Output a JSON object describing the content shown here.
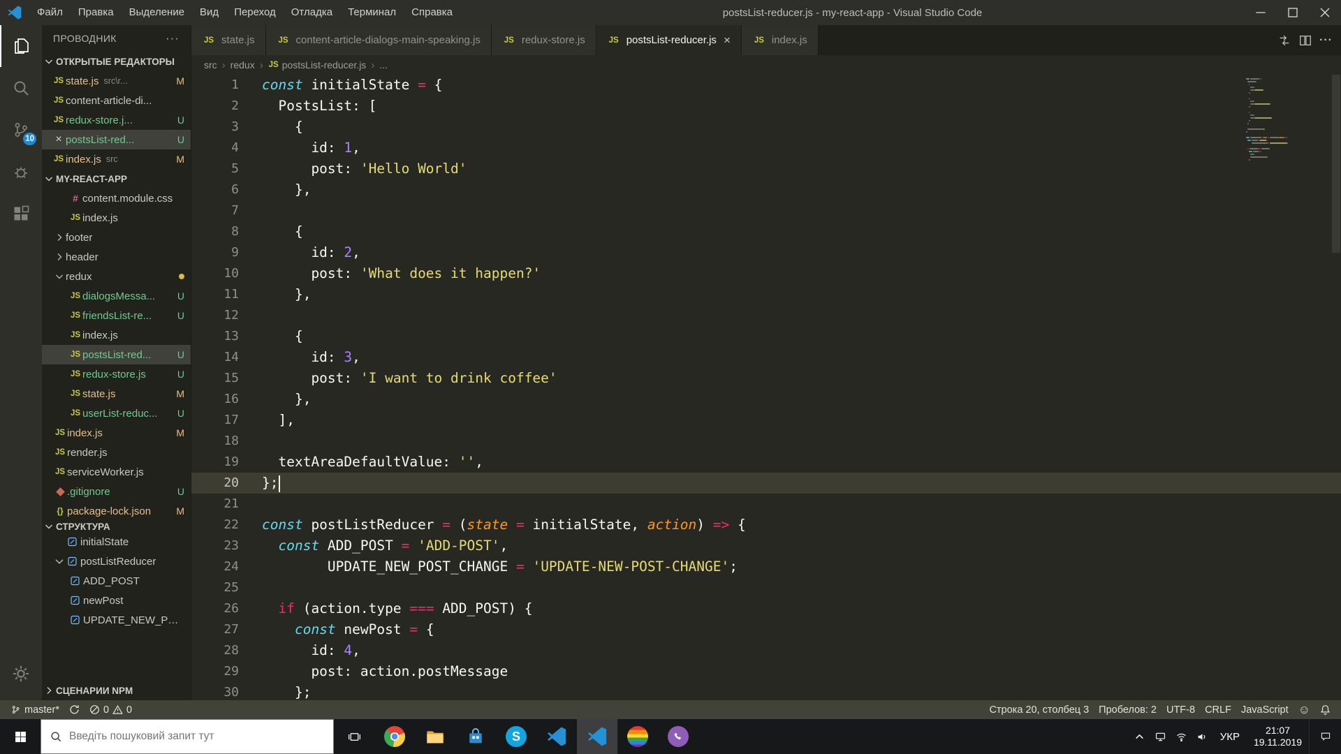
{
  "titlebar": {
    "menus": [
      "Файл",
      "Правка",
      "Выделение",
      "Вид",
      "Переход",
      "Отладка",
      "Терминал",
      "Справка"
    ],
    "title": "postsList-reducer.js - my-react-app - Visual Studio Code"
  },
  "activitybar": {
    "items": [
      {
        "id": "explorer",
        "icon": "files",
        "active": true
      },
      {
        "id": "search",
        "icon": "search"
      },
      {
        "id": "source-control",
        "icon": "git",
        "badge": "10"
      },
      {
        "id": "debug",
        "icon": "debug"
      },
      {
        "id": "extensions",
        "icon": "ext"
      }
    ]
  },
  "sidebar": {
    "title": "ПРОВОДНИК",
    "open_editors": {
      "label": "ОТКРЫТЫЕ РЕДАКТОРЫ",
      "items": [
        {
          "name": "state.js",
          "detail": "src\\r...",
          "badge": "M",
          "status": "modified"
        },
        {
          "name": "content-article-di...",
          "badge": "",
          "status": "none"
        },
        {
          "name": "redux-store.j...",
          "badge": "U",
          "status": "untracked"
        },
        {
          "name": "postsList-red...",
          "badge": "U",
          "status": "untracked",
          "active": true
        },
        {
          "name": "index.js",
          "detail": "src",
          "badge": "M",
          "status": "modified"
        }
      ]
    },
    "files": {
      "label": "MY-REACT-APP",
      "items": [
        {
          "name": "content.module.css",
          "icon": "css",
          "level": 2
        },
        {
          "name": "index.js",
          "icon": "js",
          "level": 2
        },
        {
          "name": "footer",
          "type": "folder",
          "expanded": false,
          "level": 1
        },
        {
          "name": "header",
          "type": "folder",
          "expanded": false,
          "level": 1
        },
        {
          "name": "redux",
          "type": "folder",
          "expanded": true,
          "level": 1,
          "dot": true
        },
        {
          "name": "dialogsMessa...",
          "icon": "js",
          "level": 2,
          "badge": "U",
          "status": "untracked"
        },
        {
          "name": "friendsList-re...",
          "icon": "js",
          "level": 2,
          "badge": "U",
          "status": "untracked"
        },
        {
          "name": "index.js",
          "icon": "js",
          "level": 2
        },
        {
          "name": "postsList-red...",
          "icon": "js",
          "level": 2,
          "badge": "U",
          "status": "untracked",
          "selected": true
        },
        {
          "name": "redux-store.js",
          "icon": "js",
          "level": 2,
          "badge": "U",
          "status": "untracked"
        },
        {
          "name": "state.js",
          "icon": "js",
          "level": 2,
          "badge": "M",
          "status": "modified"
        },
        {
          "name": "userList-reduc...",
          "icon": "js",
          "level": 2,
          "badge": "U",
          "status": "untracked"
        },
        {
          "name": "index.js",
          "icon": "js",
          "level": 1,
          "badge": "M",
          "status": "modified"
        },
        {
          "name": "render.js",
          "icon": "js",
          "level": 1
        },
        {
          "name": "serviceWorker.js",
          "icon": "js",
          "level": 1
        },
        {
          "name": ".gitignore",
          "icon": "git",
          "level": 1,
          "badge": "U",
          "status": "untracked"
        },
        {
          "name": "package-lock.json",
          "icon": "json",
          "level": 1,
          "badge": "M",
          "status": "modified"
        }
      ]
    },
    "outline": {
      "label": "СТРУКТУРА",
      "items": [
        {
          "name": "initialState",
          "level": 1
        },
        {
          "name": "postListReducer",
          "level": 1,
          "expanded": true
        },
        {
          "name": "ADD_POST",
          "level": 2
        },
        {
          "name": "newPost",
          "level": 2
        },
        {
          "name": "UPDATE_NEW_PO...",
          "level": 2
        }
      ]
    },
    "npm": {
      "label": "СЦЕНАРИИ NPM"
    }
  },
  "editor": {
    "tabs": [
      {
        "name": "state.js"
      },
      {
        "name": "content-article-dialogs-main-speaking.js"
      },
      {
        "name": "redux-store.js"
      },
      {
        "name": "postsList-reducer.js",
        "active": true
      },
      {
        "name": "index.js"
      }
    ],
    "breadcrumbs": [
      "src",
      "redux",
      "postsList-reducer.js",
      "..."
    ],
    "code": {
      "current_line": 20,
      "cursor_column": 3,
      "lines": [
        {
          "n": 1,
          "t": [
            [
              "kw",
              "const"
            ],
            [
              "pl",
              " initialState "
            ],
            [
              "op",
              "="
            ],
            [
              "pl",
              " {"
            ]
          ]
        },
        {
          "n": 2,
          "t": [
            [
              "pl",
              "  PostsList: ["
            ]
          ]
        },
        {
          "n": 3,
          "t": [
            [
              "pl",
              "    {"
            ]
          ]
        },
        {
          "n": 4,
          "t": [
            [
              "pl",
              "      id: "
            ],
            [
              "num",
              "1"
            ],
            [
              "pl",
              ","
            ]
          ]
        },
        {
          "n": 5,
          "t": [
            [
              "pl",
              "      post: "
            ],
            [
              "str",
              "'Hello World'"
            ]
          ]
        },
        {
          "n": 6,
          "t": [
            [
              "pl",
              "    },"
            ]
          ]
        },
        {
          "n": 7,
          "t": []
        },
        {
          "n": 8,
          "t": [
            [
              "pl",
              "    {"
            ]
          ]
        },
        {
          "n": 9,
          "t": [
            [
              "pl",
              "      id: "
            ],
            [
              "num",
              "2"
            ],
            [
              "pl",
              ","
            ]
          ]
        },
        {
          "n": 10,
          "t": [
            [
              "pl",
              "      post: "
            ],
            [
              "str",
              "'What does it happen?'"
            ]
          ]
        },
        {
          "n": 11,
          "t": [
            [
              "pl",
              "    },"
            ]
          ]
        },
        {
          "n": 12,
          "t": []
        },
        {
          "n": 13,
          "t": [
            [
              "pl",
              "    {"
            ]
          ]
        },
        {
          "n": 14,
          "t": [
            [
              "pl",
              "      id: "
            ],
            [
              "num",
              "3"
            ],
            [
              "pl",
              ","
            ]
          ]
        },
        {
          "n": 15,
          "t": [
            [
              "pl",
              "      post: "
            ],
            [
              "str",
              "'I want to drink coffee'"
            ]
          ]
        },
        {
          "n": 16,
          "t": [
            [
              "pl",
              "    },"
            ]
          ]
        },
        {
          "n": 17,
          "t": [
            [
              "pl",
              "  ],"
            ]
          ]
        },
        {
          "n": 18,
          "t": []
        },
        {
          "n": 19,
          "t": [
            [
              "pl",
              "  textAreaDefaultValue: "
            ],
            [
              "str",
              "''"
            ],
            [
              "pl",
              ","
            ]
          ]
        },
        {
          "n": 20,
          "t": [
            [
              "pl",
              "};"
            ]
          ]
        },
        {
          "n": 21,
          "t": []
        },
        {
          "n": 22,
          "t": [
            [
              "kw",
              "const"
            ],
            [
              "pl",
              " postListReducer "
            ],
            [
              "op",
              "="
            ],
            [
              "pl",
              " ("
            ],
            [
              "param",
              "state"
            ],
            [
              "pl",
              " "
            ],
            [
              "op",
              "="
            ],
            [
              "pl",
              " initialState, "
            ],
            [
              "param",
              "action"
            ],
            [
              "pl",
              ") "
            ],
            [
              "op",
              "=>"
            ],
            [
              "pl",
              " {"
            ]
          ]
        },
        {
          "n": 23,
          "t": [
            [
              "pl",
              "  "
            ],
            [
              "kw",
              "const"
            ],
            [
              "pl",
              " ADD_POST "
            ],
            [
              "op",
              "="
            ],
            [
              "pl",
              " "
            ],
            [
              "str",
              "'ADD-POST'"
            ],
            [
              "pl",
              ","
            ]
          ]
        },
        {
          "n": 24,
          "t": [
            [
              "pl",
              "        UPDATE_NEW_POST_CHANGE "
            ],
            [
              "op",
              "="
            ],
            [
              "pl",
              " "
            ],
            [
              "str",
              "'UPDATE-NEW-POST-CHANGE'"
            ],
            [
              "pl",
              ";"
            ]
          ]
        },
        {
          "n": 25,
          "t": []
        },
        {
          "n": 26,
          "t": [
            [
              "pl",
              "  "
            ],
            [
              "ctrl",
              "if"
            ],
            [
              "pl",
              " (action.type "
            ],
            [
              "op",
              "==="
            ],
            [
              "pl",
              " ADD_POST) {"
            ]
          ]
        },
        {
          "n": 27,
          "t": [
            [
              "pl",
              "    "
            ],
            [
              "kw",
              "const"
            ],
            [
              "pl",
              " newPost "
            ],
            [
              "op",
              "="
            ],
            [
              "pl",
              " {"
            ]
          ]
        },
        {
          "n": 28,
          "t": [
            [
              "pl",
              "      id: "
            ],
            [
              "num",
              "4"
            ],
            [
              "pl",
              ","
            ]
          ]
        },
        {
          "n": 29,
          "t": [
            [
              "pl",
              "      post: action.postMessage"
            ]
          ]
        },
        {
          "n": 30,
          "t": [
            [
              "pl",
              "    };"
            ]
          ]
        }
      ]
    }
  },
  "statusbar": {
    "branch": "master*",
    "errors": "0",
    "warnings": "0",
    "cursor_position": "Строка 20, столбец 3",
    "indentation": "Пробелов: 2",
    "encoding": "UTF-8",
    "eol": "CRLF",
    "language": "JavaScript"
  },
  "taskbar": {
    "search_placeholder": "Введіть пошуковий запит тут",
    "apps": [
      {
        "id": "chrome",
        "icon": "chrome"
      },
      {
        "id": "file-explorer",
        "icon": "explorer"
      },
      {
        "id": "store",
        "icon": "store"
      },
      {
        "id": "skype",
        "icon": "skype"
      },
      {
        "id": "vscode-1",
        "icon": "vscode"
      },
      {
        "id": "vscode-2",
        "icon": "vscode",
        "active": true
      },
      {
        "id": "color-app",
        "icon": "rainbow"
      },
      {
        "id": "viber",
        "icon": "viber"
      }
    ],
    "lang": "УКР",
    "time": "21:07",
    "date": "19.11.2019"
  }
}
